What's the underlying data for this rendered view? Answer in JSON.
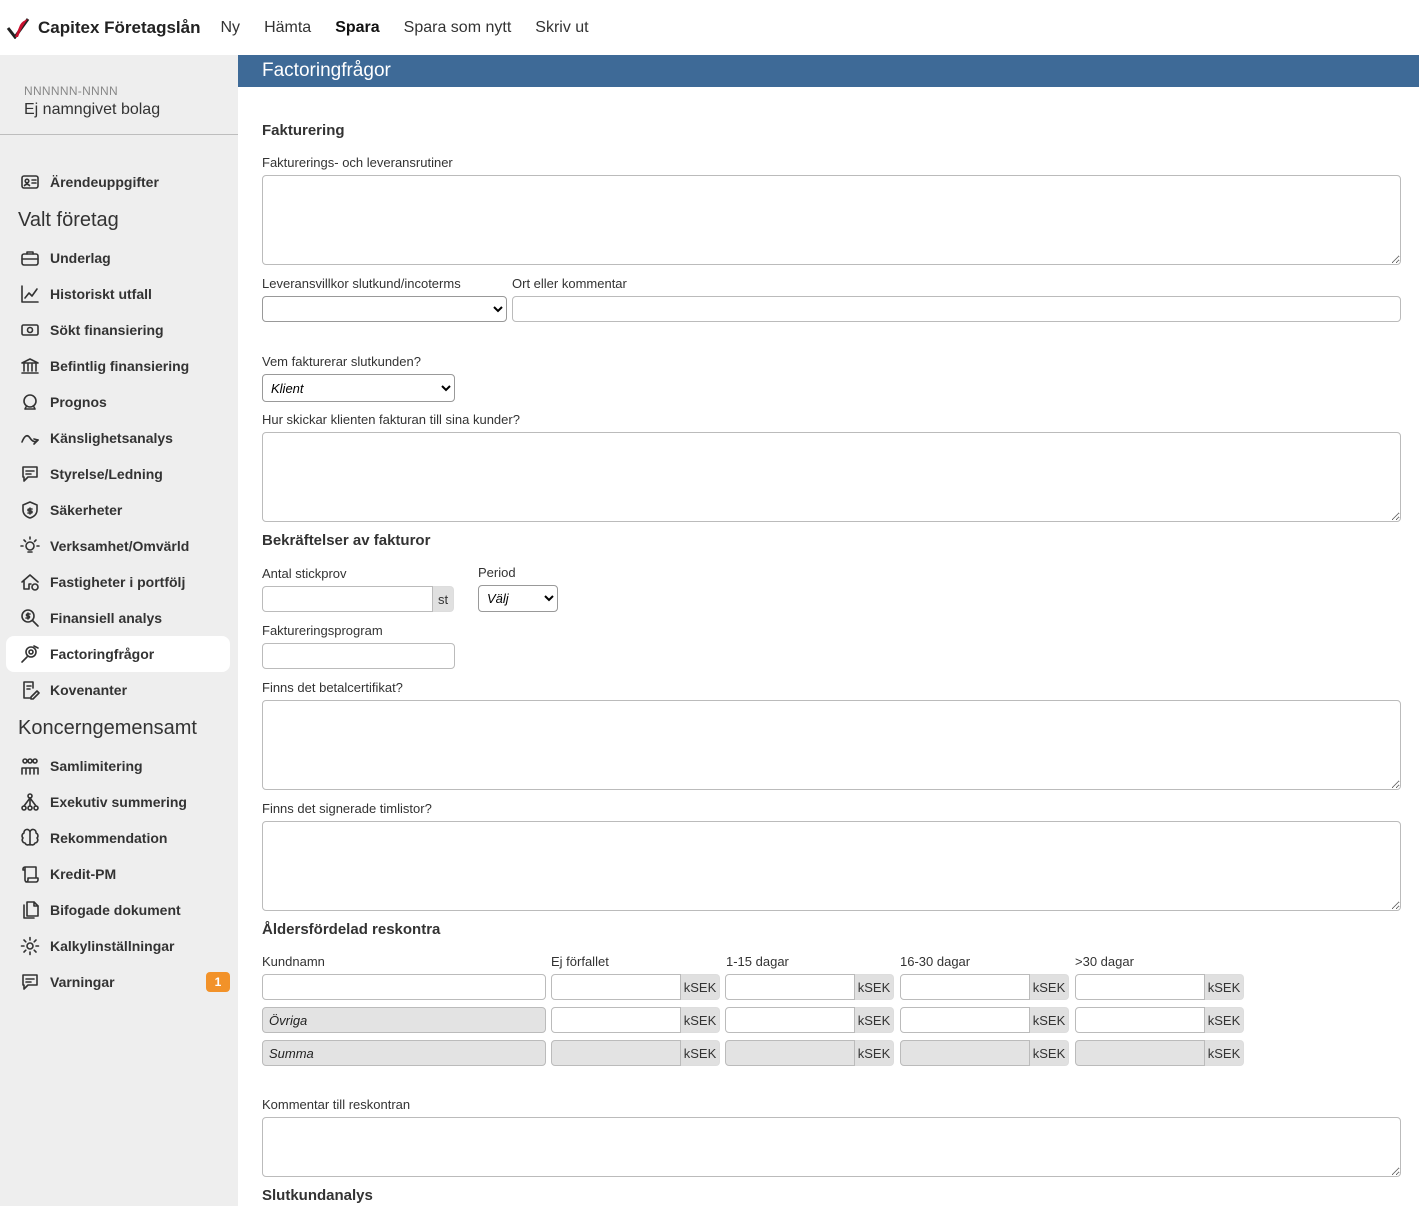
{
  "brand": {
    "name": "Capitex Företagslån"
  },
  "topnav": {
    "items": [
      "Ny",
      "Hämta",
      "Spara",
      "Spara som nytt",
      "Skriv ut"
    ]
  },
  "company": {
    "id": "NNNNNN-NNNN",
    "name": "Ej namngivet bolag"
  },
  "sidebar": {
    "top_item": "Ärendeuppgifter",
    "section1": "Valt företag",
    "items1": [
      "Underlag",
      "Historiskt utfall",
      "Sökt finansiering",
      "Befintlig finansiering",
      "Prognos",
      "Känslighetsanalys",
      "Styrelse/Ledning",
      "Säkerheter",
      "Verksamhet/Omvärld",
      "Fastigheter i portfölj",
      "Finansiell analys",
      "Factoringfrågor",
      "Kovenanter"
    ],
    "section2": "Koncerngemensamt",
    "items2": [
      "Samlimitering",
      "Exekutiv summering",
      "Rekommendation",
      "Kredit-PM",
      "Bifogade dokument",
      "Kalkylinställningar",
      "Varningar"
    ],
    "warnings_badge": "1"
  },
  "page": {
    "title": "Factoringfrågor",
    "fakturering": {
      "heading": "Fakturering",
      "rutiner_label": "Fakturerings- och leveransrutiner",
      "leveransvillkor_label": "Leveransvillkor slutkund/incoterms",
      "ort_label": "Ort eller kommentar",
      "vem_label": "Vem fakturerar slutkunden?",
      "vem_value": "Klient",
      "hur_label": "Hur skickar klienten fakturan till sina kunder?"
    },
    "bekraftelser": {
      "heading": "Bekräftelser av fakturor",
      "antal_label": "Antal stickprov",
      "antal_suffix": "st",
      "period_label": "Period",
      "period_value": "Välj",
      "program_label": "Faktureringsprogram",
      "betalcert_label": "Finns det betalcertifikat?",
      "timlistor_label": "Finns det signerade timlistor?"
    },
    "reskontra": {
      "heading": "Åldersfördelad reskontra",
      "columns": [
        "Kundnamn",
        "Ej förfallet",
        "1-15 dagar",
        "16-30 dagar",
        ">30 dagar"
      ],
      "unit": "kSEK",
      "rows": [
        "",
        "Övriga",
        "Summa"
      ],
      "kommentar_label": "Kommentar till reskontran"
    },
    "slutkund_heading": "Slutkundanalys"
  }
}
